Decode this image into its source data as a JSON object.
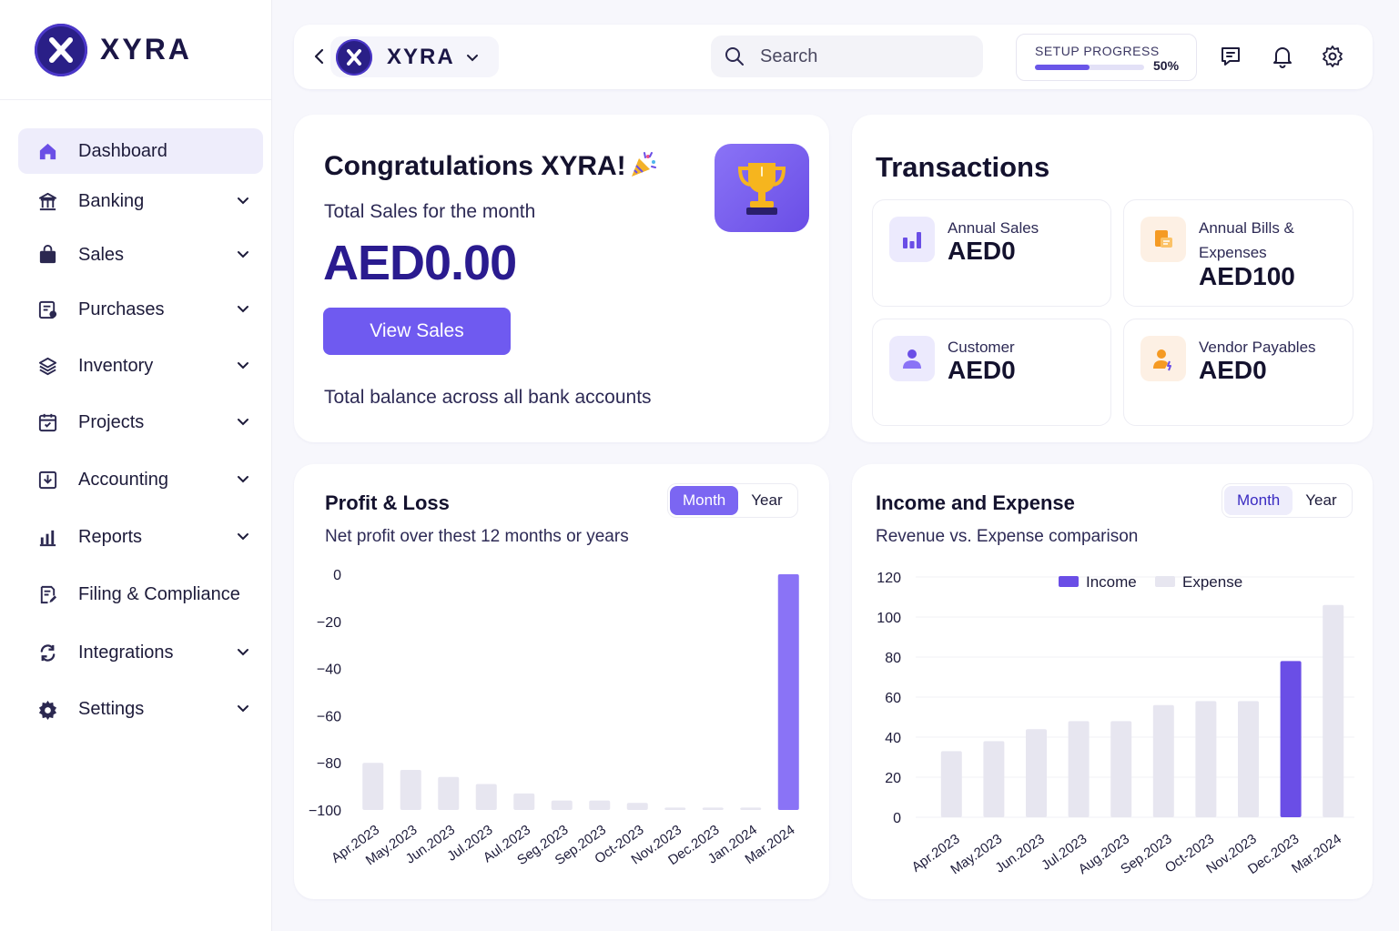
{
  "brand": {
    "name": "XYRA"
  },
  "sidebar": {
    "items": [
      {
        "label": "Dashboard",
        "icon": "home-icon",
        "active": true,
        "expandable": false
      },
      {
        "label": "Banking",
        "icon": "bank-icon",
        "expandable": true
      },
      {
        "label": "Sales",
        "icon": "shopping-bag-icon",
        "expandable": true
      },
      {
        "label": "Purchases",
        "icon": "purchase-icon",
        "expandable": true
      },
      {
        "label": "Inventory",
        "icon": "layers-icon",
        "expandable": true
      },
      {
        "label": "Projects",
        "icon": "calendar-icon",
        "expandable": true
      },
      {
        "label": "Accounting",
        "icon": "download-box-icon",
        "expandable": true
      },
      {
        "label": "Reports",
        "icon": "bar-chart-icon",
        "expandable": true
      },
      {
        "label": "Filing & Compliance",
        "icon": "file-edit-icon",
        "expandable": false
      },
      {
        "label": "Integrations",
        "icon": "sync-icon",
        "expandable": true
      },
      {
        "label": "Settings",
        "icon": "gear-icon",
        "expandable": true
      }
    ]
  },
  "topbar": {
    "org_name": "XYRA",
    "search_placeholder": "Search",
    "setup_label": "SETUP PROGRESS",
    "setup_percent_text": "50%",
    "setup_progress": 0.5
  },
  "congrats": {
    "title": "Congratulations XYRA!",
    "subtitle": "Total Sales for the month",
    "amount": "AED0.00",
    "button": "View Sales",
    "footer": "Total balance across all bank accounts"
  },
  "transactions": {
    "title": "Transactions",
    "tiles": [
      {
        "label": "Annual Sales",
        "value": "AED0",
        "icon": "bar-chart-icon"
      },
      {
        "label": "Annual Bills & Expenses",
        "value": "AED100",
        "icon": "bills-icon"
      },
      {
        "label": "Customer",
        "value": "AED0",
        "icon": "user-icon"
      },
      {
        "label": "Vendor Payables",
        "value": "AED0",
        "icon": "vendor-icon"
      }
    ]
  },
  "profit_loss": {
    "title": "Profit & Loss",
    "subtitle": "Net profit over thest 12 months or years",
    "toggle": [
      "Month",
      "Year"
    ],
    "active": "Month"
  },
  "income_expense": {
    "title": "Income and Expense",
    "subtitle": "Revenue vs. Expense comparison",
    "toggle": [
      "Month",
      "Year"
    ],
    "active": "Month"
  },
  "colors": {
    "accent": "#6f5af0",
    "accent_dark": "#2a1b8f",
    "bar_grey": "#e7e6f0",
    "income": "#6a4ee6"
  },
  "chart_data": [
    {
      "type": "bar",
      "title": "Profit & Loss",
      "categories": [
        "Apr.2023",
        "May.2023",
        "Jun.2023",
        "Jul.2023",
        "Aul.2023",
        "Seg.2023",
        "Sep.2023",
        "Oct-2023",
        "Nov.2023",
        "Dec.2023",
        "Jan.2024",
        "Mar.2024"
      ],
      "values": [
        -80,
        -83,
        -86,
        -89,
        -93,
        -96,
        -96,
        -97,
        -99,
        -99,
        -99,
        0
      ],
      "ylim": [
        -100,
        0
      ],
      "yticks": [
        0,
        -20,
        -40,
        -60,
        -80,
        -100
      ],
      "highlight_index": 11,
      "grid": false
    },
    {
      "type": "bar",
      "title": "Income and Expense",
      "categories": [
        "Apr.2023",
        "May.2023",
        "Jun.2023",
        "Jul.2023",
        "Aug.2023",
        "Sep.2023",
        "Oct-2023",
        "Nov.2023",
        "Dec.2023",
        "Mar.2024"
      ],
      "series": [
        {
          "name": "Income",
          "values": [
            null,
            null,
            null,
            null,
            null,
            null,
            null,
            null,
            78,
            null
          ]
        },
        {
          "name": "Expense",
          "values": [
            33,
            38,
            44,
            48,
            48,
            56,
            58,
            58,
            null,
            106
          ]
        }
      ],
      "ylim": [
        0,
        120
      ],
      "yticks": [
        120,
        100,
        80,
        60,
        40,
        20,
        0
      ],
      "legend": "top-center",
      "grid": true
    }
  ]
}
